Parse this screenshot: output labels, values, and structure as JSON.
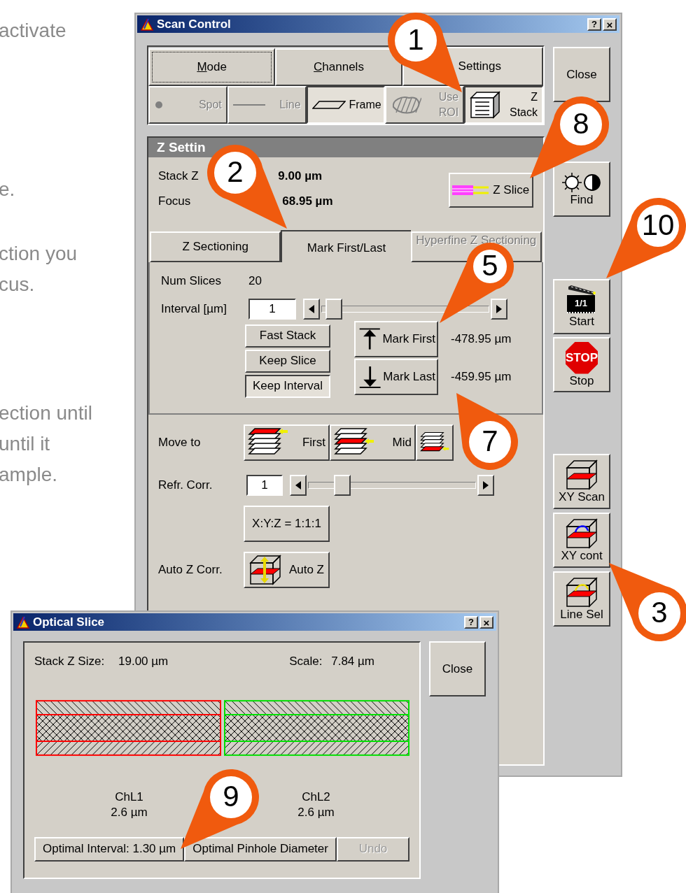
{
  "background_text": [
    {
      "lines": [
        "activate"
      ]
    },
    {
      "lines": [
        "e."
      ]
    },
    {
      "lines": [
        "ction you",
        "cus."
      ]
    },
    {
      "lines": [
        "ection until",
        "until it",
        "ample."
      ]
    }
  ],
  "scan_control": {
    "title": "Scan Control",
    "help": "?",
    "close": "×",
    "tabs": [
      {
        "label": "Mode",
        "selected": false,
        "focused": true
      },
      {
        "label": "Channels",
        "selected": false,
        "focused": false
      },
      {
        "label": "Settings",
        "selected": true,
        "focused": false
      }
    ],
    "tools": [
      {
        "label": "Spot",
        "kind": "spot",
        "disabled": true,
        "selected": false
      },
      {
        "label": "Line",
        "kind": "line",
        "disabled": true,
        "selected": false
      },
      {
        "label": "Frame",
        "kind": "frame",
        "disabled": false,
        "selected": true
      },
      {
        "label": "Use ROI",
        "kind": "roi",
        "disabled": true,
        "selected": false
      },
      {
        "label": "Z Stack",
        "kind": "stack",
        "disabled": false,
        "selected": true
      }
    ],
    "z_panel": {
      "header": "Z Settin",
      "stack_label": "Stack Z",
      "stack_value": "9.00 µm",
      "focus_label": "Focus",
      "focus_value": "68.95 µm",
      "z_slice": "Z Slice",
      "subtabs": [
        {
          "label": "Z Sectioning",
          "selected": false,
          "disabled": false
        },
        {
          "label": "Mark First/Last",
          "selected": true,
          "disabled": false
        },
        {
          "label": "Hyperfine Z Sectioning",
          "selected": false,
          "disabled": true
        }
      ],
      "num_slices_label": "Num Slices",
      "num_slices_value": "20",
      "interval": {
        "label": "Interval [µm]",
        "value": "1",
        "level": 0.03
      },
      "options": [
        {
          "label": "Fast Stack",
          "selected": false
        },
        {
          "label": "Keep Slice",
          "selected": false
        },
        {
          "label": "Keep Interval",
          "selected": true
        }
      ],
      "marks": [
        {
          "label": "Mark First",
          "kind": "first",
          "value": "-478.95 µm"
        },
        {
          "label": "Mark Last",
          "kind": "last",
          "value": "-459.95 µm"
        }
      ],
      "move_to": {
        "label": "Move to",
        "buttons": [
          {
            "label": "First",
            "kind": "first"
          },
          {
            "label": "Mid",
            "kind": "mid"
          },
          {
            "kind": "last"
          }
        ]
      },
      "refr": {
        "label": "Refr. Corr.",
        "value": "1",
        "level": 0.17
      },
      "ratio_button": "X:Y:Z = 1:1:1",
      "auto_z": {
        "label": "Auto Z Corr.",
        "button": "Auto Z"
      }
    },
    "side_buttons": [
      {
        "label": "Close",
        "kind": "close"
      },
      {
        "label": "Find",
        "kind": "find"
      },
      {
        "label": "Start",
        "kind": "start",
        "badge": "1/1"
      },
      {
        "label": "Stop",
        "kind": "stop",
        "badge": "STOP"
      },
      {
        "label": "XY Scan",
        "kind": "xy-scan"
      },
      {
        "label": "XY cont",
        "kind": "xy-cont"
      },
      {
        "label": "Line Sel",
        "kind": "line-sel"
      }
    ]
  },
  "optical_slice": {
    "title": "Optical Slice",
    "help": "?",
    "close": "×",
    "stack_label": "Stack Z Size:",
    "stack_value": "19.00 µm",
    "scale_label": "Scale:",
    "scale_value": "7.84 µm",
    "channels": [
      {
        "name": "ChL1",
        "value": "2.6 µm",
        "color": "#ff0000"
      },
      {
        "name": "ChL2",
        "value": "2.6 µm",
        "color": "#00e000"
      }
    ],
    "buttons": [
      {
        "label": "Optimal Interval: 1.30 µm",
        "disabled": false
      },
      {
        "label": "Optimal Pinhole Diameter",
        "disabled": false
      },
      {
        "label": "Undo",
        "disabled": true
      }
    ],
    "close_button": "Close"
  },
  "callouts": [
    {
      "number": "1"
    },
    {
      "number": "8"
    },
    {
      "number": "2"
    },
    {
      "number": "10"
    },
    {
      "number": "5"
    },
    {
      "number": "7"
    },
    {
      "number": "3"
    },
    {
      "number": "9"
    }
  ]
}
